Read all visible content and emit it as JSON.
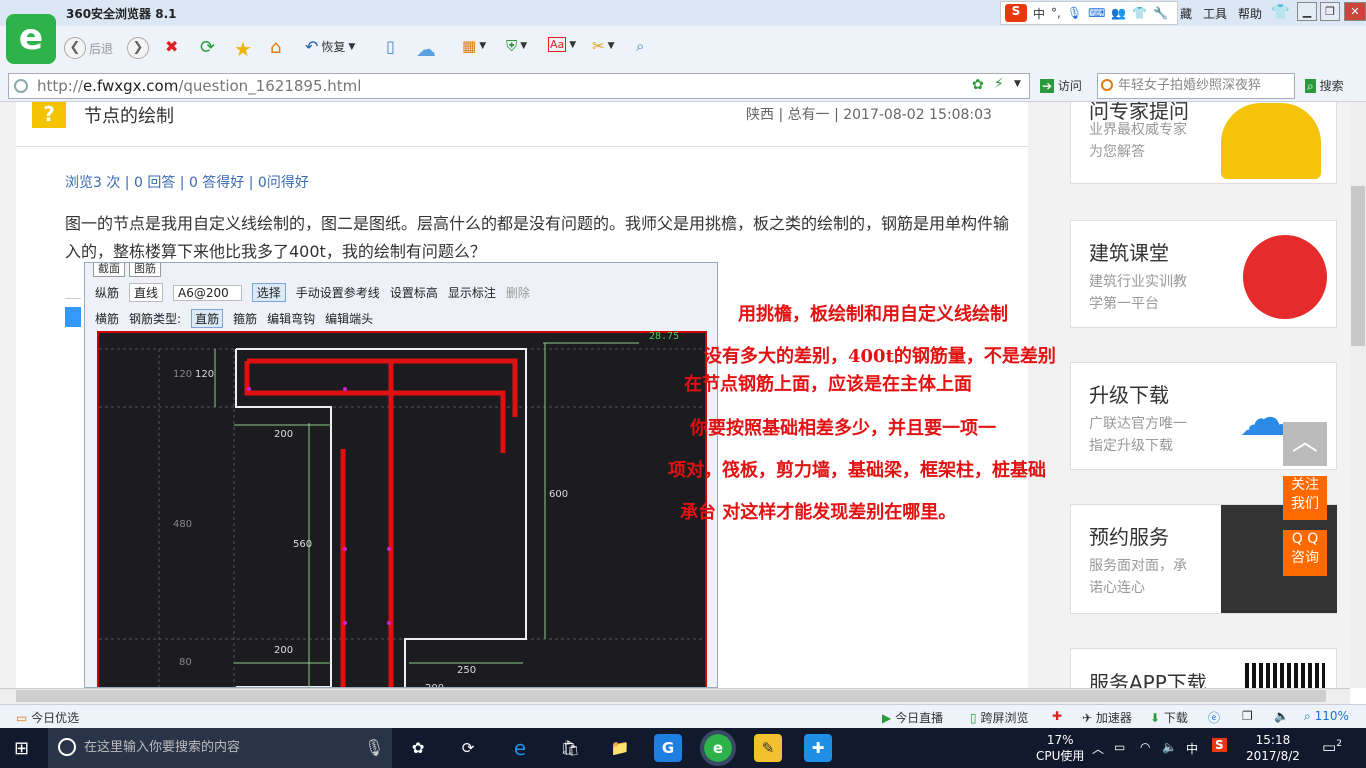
{
  "browser": {
    "title": "360安全浏览器 8.1",
    "menu": [
      "工具",
      "帮助"
    ],
    "menu_partial": "藏",
    "ime": {
      "mode": "中"
    },
    "toolbar": {
      "back": "后退",
      "restore": "恢复"
    },
    "address": {
      "scheme": "http://",
      "host": "e.fwxgx.com",
      "path": "/question_1621895.html"
    },
    "visit_label": "访问",
    "search_placeholder": "年轻女子拍婚纱照深夜猝",
    "search_label": "搜索"
  },
  "question": {
    "title": "节点的绘制",
    "meta": "陕西 | 总有一 | 2017-08-02 15:08:03",
    "stats": "浏览3 次 | 0 回答 | 0 答得好 | 0问得好",
    "body": "图一的节点是我用自定义线绘制的，图二是图纸。层高什么的都是没有问题的。我师父是用挑檐，板之类的绘制的，钢筋是用单构件输入的，整栋楼算下来他比我多了400t，我的绘制有问题么？"
  },
  "screenshot": {
    "tabs": [
      "截面",
      "图筋"
    ],
    "row1": [
      "纵筋",
      "直线",
      "A6@200",
      "选择",
      "手动设置参考线",
      "设置标高",
      "显示标注",
      "删除"
    ],
    "row2": [
      "横筋",
      "钢筋类型:",
      "直筋",
      "箍筋",
      "编辑弯钩",
      "编辑端头"
    ],
    "cad_labels": {
      "top_right": "28.75",
      "dim_120a": "120",
      "dim_120b": "120",
      "dim_200a": "200",
      "dim_480": "480",
      "dim_560": "560",
      "dim_600": "600",
      "dim_80": "80",
      "dim_200b": "200",
      "dim_250": "250",
      "dim_200c": "200"
    }
  },
  "annotation": {
    "lines": [
      "用挑檐，板绘制和用自定义线绘制",
      "没有多大的差别，400t的钢筋量，不是差别",
      "在节点钢筋上面，应该是在主体上面",
      "你要按照基础相差多少，并且要一项一",
      "项对，筏板，剪力墙，基础梁，框架柱，桩基础",
      "承台 对这样才能发现差别在哪里。"
    ]
  },
  "sidebar": {
    "ask_expert": {
      "title": "问专家提问",
      "sub": [
        "业界最权威专家",
        "为您解答"
      ]
    },
    "course": {
      "title": "建筑课堂",
      "sub": [
        "建筑行业实训教",
        "学第一平台"
      ]
    },
    "upgrade": {
      "title": "升级下载",
      "sub": [
        "广联达官方唯一",
        "指定升级下载"
      ]
    },
    "booking": {
      "title": "预约服务",
      "sub": [
        "服务面对面，承",
        "诺心连心"
      ]
    },
    "app": {
      "title": "服务APP下载"
    },
    "float_follow": [
      "关注",
      "我们"
    ],
    "float_qq": [
      "Q Q",
      "咨询"
    ]
  },
  "statusbar": {
    "left": "今日优选",
    "live": "今日直播",
    "cast": "跨屏浏览",
    "speed": "加速器",
    "download": "下载",
    "zoom": "110%"
  },
  "taskbar": {
    "search_placeholder": "在这里输入你要搜索的内容",
    "cpu_pct": "17%",
    "cpu_label": "CPU使用",
    "ime": "中",
    "time": "15:18",
    "date": "2017/8/2",
    "notify_count": "2"
  },
  "colors": {
    "annotation": "#e31212",
    "link": "#3a6bb4",
    "brand_green": "#2db34a",
    "orange": "#ff6a00"
  }
}
